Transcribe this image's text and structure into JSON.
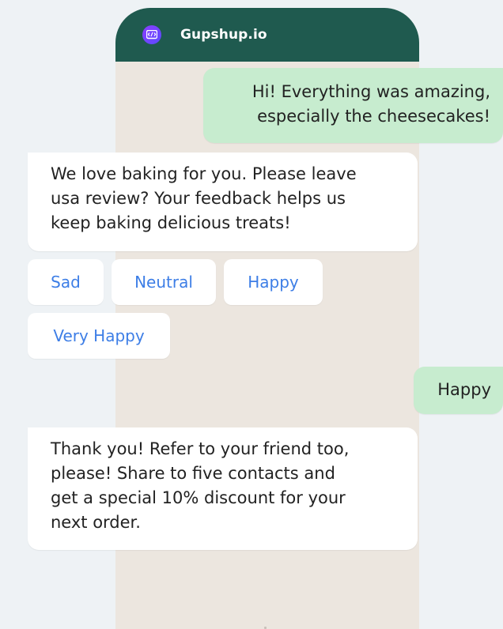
{
  "header": {
    "brand_name": "Gupshup.io",
    "logo_icon": "gupshup-logo-icon",
    "background_color": "#1f5a4f"
  },
  "messages": [
    {
      "direction": "outgoing",
      "lines": [
        "Hi! Everything was amazing,",
        "especially the cheesecakes!"
      ]
    },
    {
      "direction": "incoming",
      "lines": [
        "We love baking for you. Please leave",
        "usa review? Your feedback helps us",
        "keep baking delicious treats!"
      ]
    },
    {
      "direction": "outgoing",
      "lines": [
        "Happy"
      ]
    },
    {
      "direction": "incoming",
      "lines": [
        "Thank you! Refer to your friend too,",
        "please! Share to five contacts and",
        "get a special 10% discount for your",
        "next order."
      ]
    }
  ],
  "quick_replies": [
    {
      "label": "Sad"
    },
    {
      "label": "Neutral"
    },
    {
      "label": "Happy"
    },
    {
      "label": "Very Happy"
    }
  ],
  "colors": {
    "outgoing_bubble": "#c7eccf",
    "incoming_bubble": "#ffffff",
    "quick_reply_text": "#3d7ee6",
    "chat_background": "#ece6df",
    "page_background": "#eef2f5"
  }
}
